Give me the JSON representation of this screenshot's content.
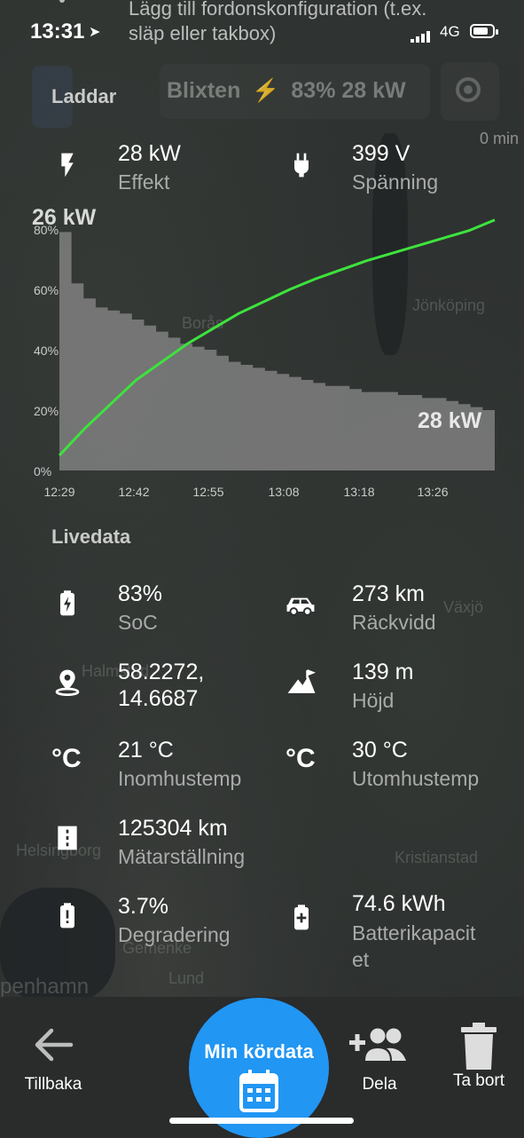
{
  "status_bar": {
    "time": "13:31",
    "network": "4G"
  },
  "top_hint": {
    "line1": "Lägg till fordonskonfiguration (t.ex.",
    "line2": "släp eller takbox)"
  },
  "header": {
    "section": "Laddar",
    "title": "Blixten",
    "title_detail": "83% 28 kW",
    "eta": "0 min"
  },
  "charging": {
    "power": {
      "value": "28 kW",
      "label": "Effekt",
      "icon": "bolt-icon"
    },
    "voltage": {
      "value": "399 V",
      "label": "Spänning",
      "icon": "plug-icon"
    }
  },
  "chart_data": {
    "type": "area",
    "x": [
      "12:29",
      "12:42",
      "12:55",
      "13:08",
      "13:18",
      "13:26"
    ],
    "yticks": [
      "0%",
      "20%",
      "40%",
      "60%",
      "80%"
    ],
    "ylim": [
      0,
      80
    ],
    "peak_label": "26 kW",
    "end_label": "28 kW",
    "series": [
      {
        "kind": "power-area",
        "values": [
          79,
          62,
          57,
          54,
          53,
          52,
          50,
          48,
          46,
          44,
          42,
          41,
          40,
          38,
          36,
          35,
          34,
          33,
          32,
          31,
          30,
          29,
          28,
          28,
          27,
          26,
          26,
          26,
          25,
          25,
          24,
          24,
          23,
          22,
          21,
          20
        ]
      },
      {
        "kind": "soc-line",
        "values": [
          5,
          14,
          22,
          30,
          36,
          42,
          47,
          52,
          56,
          60,
          63.5,
          66.5,
          69.5,
          72,
          74.5,
          77,
          79.5,
          83
        ]
      }
    ]
  },
  "livedata": {
    "title": "Livedata",
    "items": [
      {
        "value": "83%",
        "label": "SoC",
        "icon": "battery-charging-icon"
      },
      {
        "value": "273 km",
        "label": "Räckvidd",
        "icon": "car-icon"
      },
      {
        "value": "58.2272, 14.6687",
        "value_l1": "58.2272,",
        "value_l2": "14.6687",
        "label": "",
        "icon": "location-pin-icon"
      },
      {
        "value": "139 m",
        "label": "Höjd",
        "icon": "mountain-icon"
      },
      {
        "value": "21 °C",
        "label": "Inomhustemp",
        "icon": "celsius-icon"
      },
      {
        "value": "30 °C",
        "label": "Utomhustemp",
        "icon": "celsius-icon"
      },
      {
        "value": "125304 km",
        "label": "Mätarställning",
        "icon": "odometer-icon"
      },
      {
        "value": "3.7%",
        "label": "Degradering",
        "icon": "battery-alert-icon"
      },
      {
        "value": "74.6 kWh",
        "label": "Batterikapacitet",
        "label_l1": "Batterikapacit",
        "label_l2": "et",
        "icon": "battery-plus-icon"
      }
    ]
  },
  "bottom_nav": {
    "back": "Tillbaka",
    "primary": "Min kördata",
    "share": "Dela",
    "delete": "Ta bort"
  },
  "map_labels": [
    "Jönköping",
    "Borås",
    "Växjö",
    "Halmstad",
    "Helsingborg",
    "Kristianstad",
    "Lund",
    "Gemenke",
    "penhamn"
  ],
  "colors": {
    "soc_line": "#3de33d",
    "fab": "#2196f3",
    "area": "#8a8a8a"
  }
}
